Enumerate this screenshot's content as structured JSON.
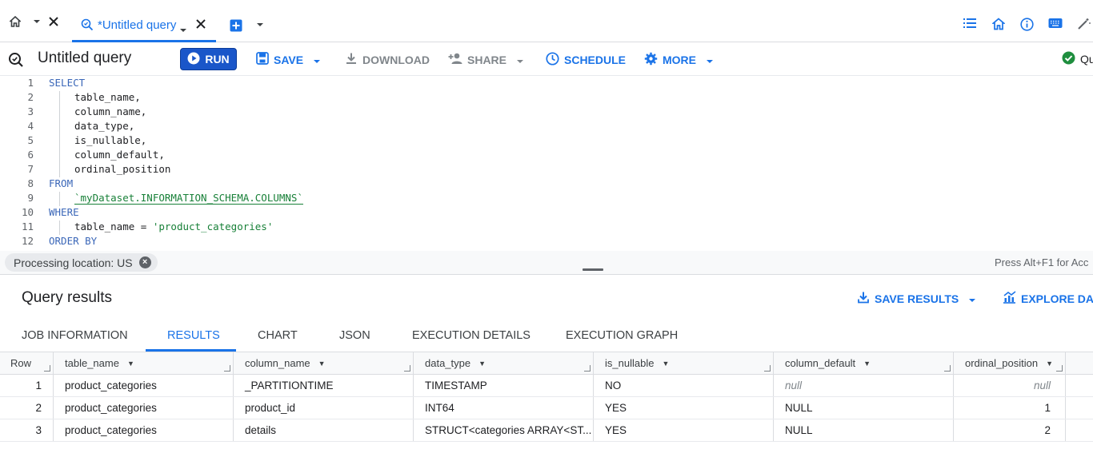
{
  "tabbar": {
    "active_tab_label": "*Untitled query"
  },
  "toolbar": {
    "query_title": "Untitled query",
    "run_label": "RUN",
    "save_label": "SAVE",
    "download_label": "DOWNLOAD",
    "share_label": "SHARE",
    "schedule_label": "SCHEDULE",
    "more_label": "MORE",
    "status_label": "Qu"
  },
  "editor": {
    "lines": [
      {
        "num": "1",
        "text": "SELECT"
      },
      {
        "num": "2",
        "text": "table_name,"
      },
      {
        "num": "3",
        "text": "column_name,"
      },
      {
        "num": "4",
        "text": "data_type,"
      },
      {
        "num": "5",
        "text": "is_nullable,"
      },
      {
        "num": "6",
        "text": "column_default,"
      },
      {
        "num": "7",
        "text": "ordinal_position"
      },
      {
        "num": "8",
        "text": "FROM"
      },
      {
        "num": "9",
        "text": "`myDataset.INFORMATION_SCHEMA.COLUMNS`"
      },
      {
        "num": "10",
        "text": "WHERE"
      },
      {
        "num": "11",
        "text": "table_name = ",
        "string": "'product_categories'"
      },
      {
        "num": "12",
        "text": "ORDER BY"
      }
    ]
  },
  "location": {
    "chip_label": "Processing location: US",
    "hint": "Press Alt+F1 for Acc"
  },
  "results": {
    "title": "Query results",
    "save_results_label": "SAVE RESULTS",
    "explore_label": "EXPLORE DAT",
    "tabs": [
      "JOB INFORMATION",
      "RESULTS",
      "CHART",
      "JSON",
      "EXECUTION DETAILS",
      "EXECUTION GRAPH"
    ],
    "columns": [
      "Row",
      "table_name",
      "column_name",
      "data_type",
      "is_nullable",
      "column_default",
      "ordinal_position"
    ],
    "rows": [
      {
        "row": "1",
        "table_name": "product_categories",
        "column_name": "_PARTITIONTIME",
        "data_type": "TIMESTAMP",
        "is_nullable": "NO",
        "column_default": "null",
        "ordinal_position": "null"
      },
      {
        "row": "2",
        "table_name": "product_categories",
        "column_name": "product_id",
        "data_type": "INT64",
        "is_nullable": "YES",
        "column_default": "NULL",
        "ordinal_position": "1"
      },
      {
        "row": "3",
        "table_name": "product_categories",
        "column_name": "details",
        "data_type": "STRUCT<categories ARRAY<ST...",
        "is_nullable": "YES",
        "column_default": "NULL",
        "ordinal_position": "2"
      }
    ]
  },
  "colors": {
    "accent": "#1a73e8",
    "run_button": "#1a56c9",
    "keyword": "#3b67b8",
    "string": "#188038",
    "success": "#1e8e3e"
  }
}
